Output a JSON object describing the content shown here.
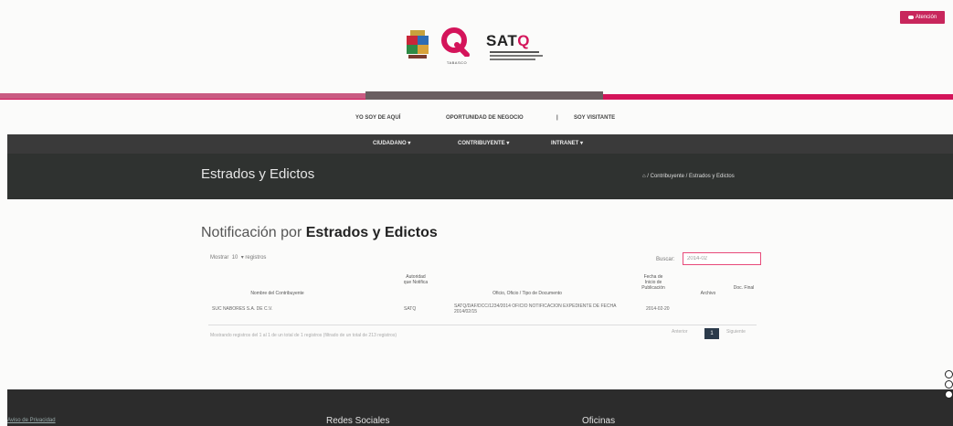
{
  "help_button": {
    "label": "Atención"
  },
  "logos": {
    "q_sub": "TABASCO",
    "satq_name": "SATQ",
    "satq_q": "Q"
  },
  "top_links": [
    "YO SOY DE AQUÍ",
    "OPORTUNIDAD DE NEGOCIO",
    "|",
    "SOY VISITANTE"
  ],
  "menu": [
    "CIUDADANO ▾",
    "CONTRIBUYENTE ▾",
    "INTRANET ▾"
  ],
  "title": "Estrados y Edictos",
  "breadcrumb": [
    "⌂",
    "/",
    "Contribuyente",
    "/",
    "Estrados y Edictos"
  ],
  "content": {
    "heading_prefix": "Notificación por ",
    "heading_bold": "Estrados y Edictos",
    "show_label": "Mostrar",
    "show_value": "10",
    "show_suffix": "▾ registros",
    "search_label": "Buscar:",
    "search_value": "2014-02"
  },
  "table": {
    "headers": [
      "Nombre del Contribuyente",
      "Autoridad que Notifica",
      "Oficio, Oficio / Tipo de Documento",
      "Fecha de Inicio de Publicación",
      "Archivo",
      "Doc. Final"
    ],
    "rows": [
      {
        "name": "SUC NABORES S.A. DE C.V.",
        "authority": "SATQ",
        "document": "SATQ/DAF/DCC/1234/2014 OFICIO NOTIFICACION EXPEDIENTE DE FECHA 2014/02/15",
        "date": "2014-02-20",
        "file": "",
        "final": ""
      }
    ]
  },
  "footer_info": "Mostrando registros del 1 al 1 de un total de 1 registros (filtrado de un total de 213 registros)",
  "pagination": {
    "prev": "Anterior",
    "current": "1",
    "next": "Siguiente"
  },
  "footer": {
    "left_link": "Aviso de Privacidad",
    "col1": "Redes Sociales",
    "col2": "Oficinas"
  }
}
